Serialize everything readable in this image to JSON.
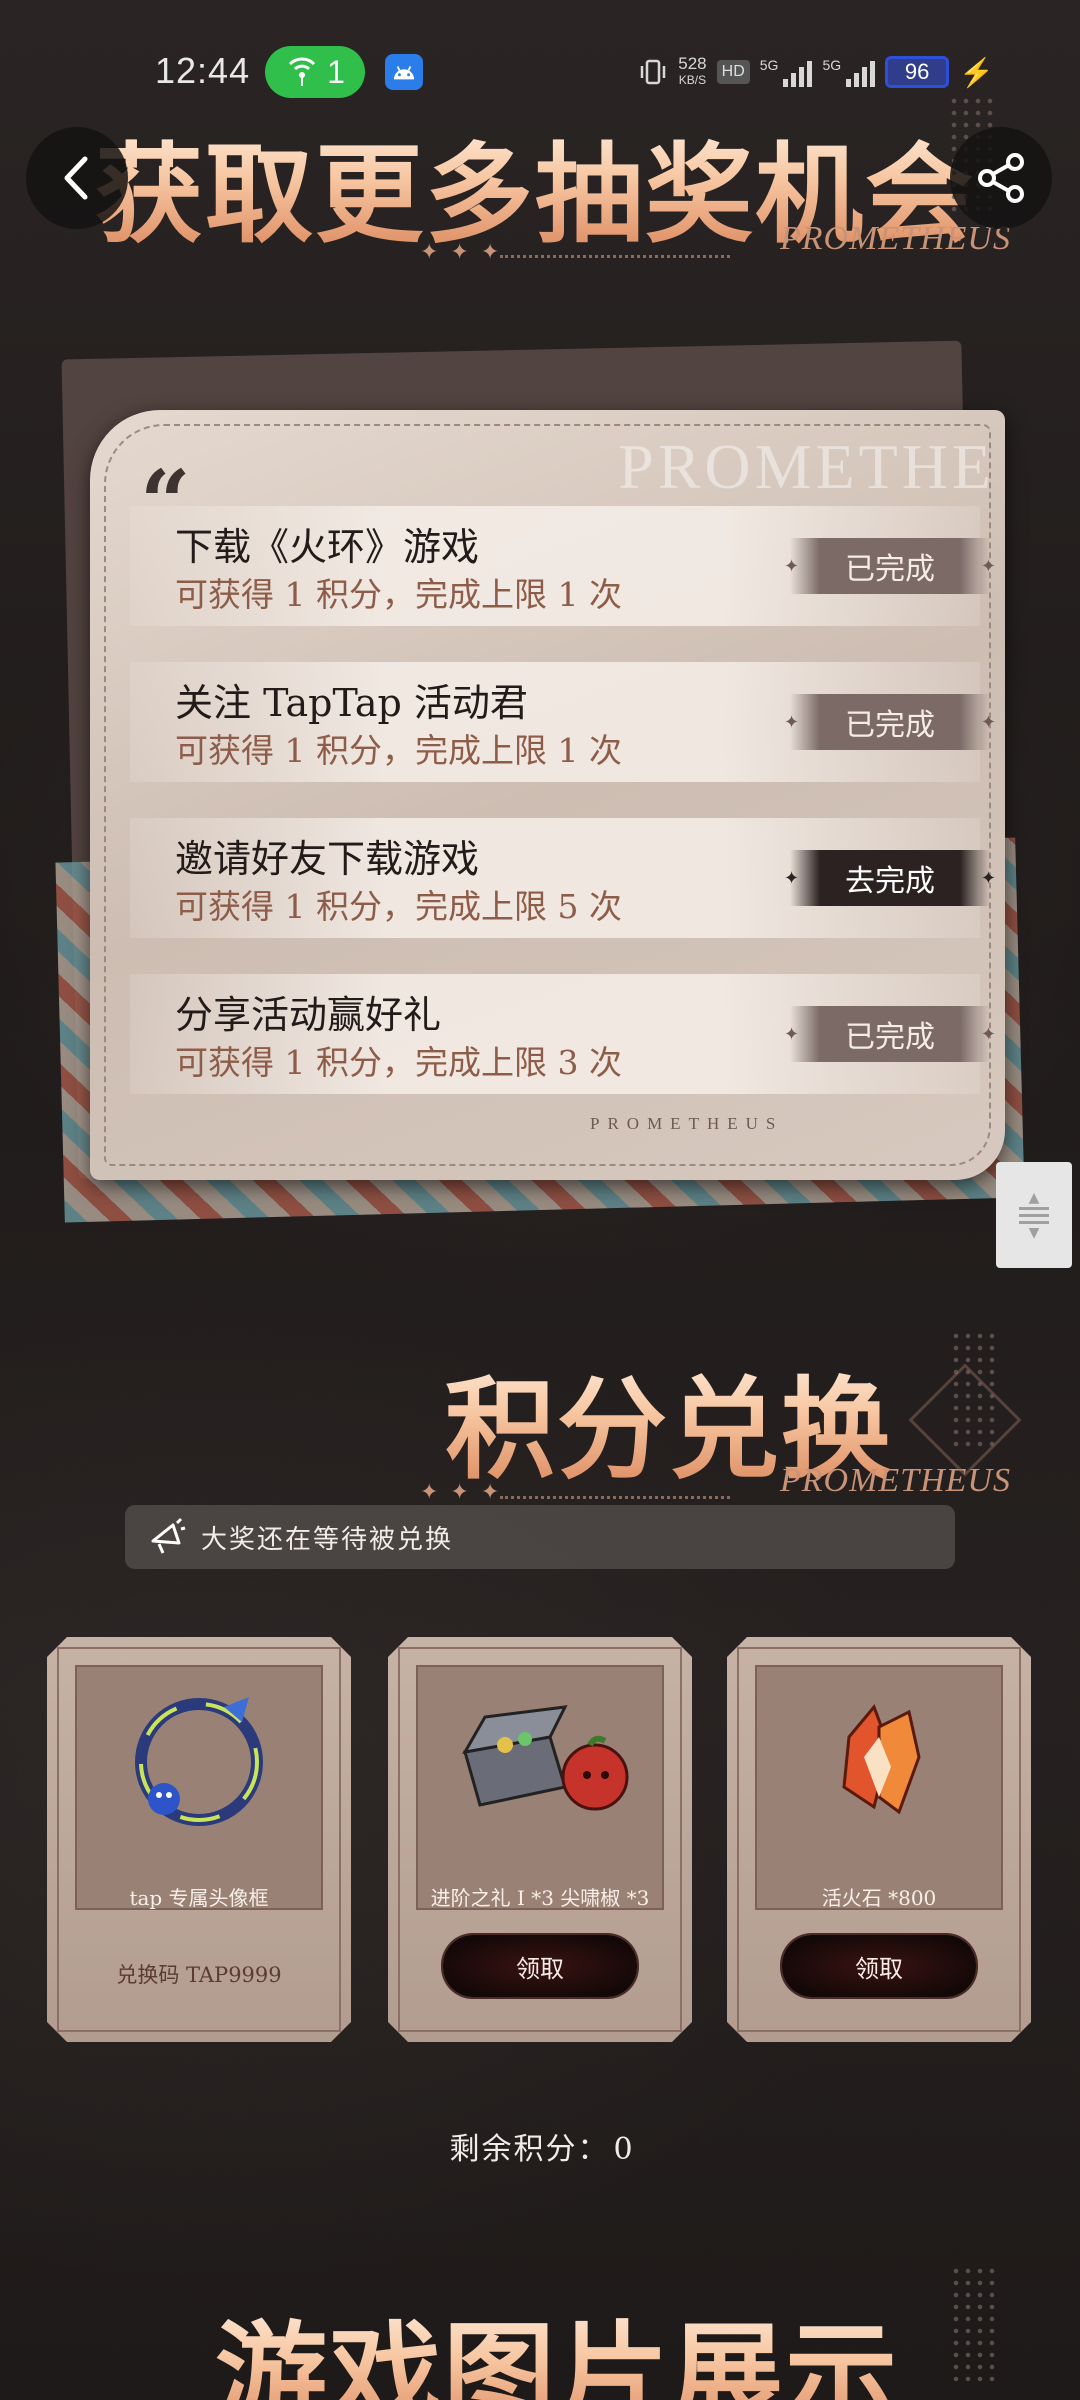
{
  "status_bar": {
    "time": "12:44",
    "hotspot_count": "1",
    "net_speed_value": "528",
    "net_speed_unit": "KB/S",
    "hd_label": "HD",
    "signal1_label": "5G",
    "signal2_label": "5G",
    "battery": "96"
  },
  "header": {
    "title": "获取更多抽奖机会",
    "subtitle": "PROMETHEUS"
  },
  "task_card": {
    "watermark": "PROMETHE",
    "footer": "PROMETHEUS",
    "tasks": [
      {
        "title": "下载《火环》游戏",
        "desc": "可获得 1 积分，完成上限 1 次",
        "button": "已完成",
        "state": "done"
      },
      {
        "title": "关注 TapTap 活动君",
        "desc": "可获得 1 积分，完成上限 1 次",
        "button": "已完成",
        "state": "done"
      },
      {
        "title": "邀请好友下载游戏",
        "desc": "可获得 1 积分，完成上限 5 次",
        "button": "去完成",
        "state": "todo"
      },
      {
        "title": "分享活动赢好礼",
        "desc": "可获得 1 积分，完成上限 3 次",
        "button": "已完成",
        "state": "done"
      }
    ]
  },
  "exchange": {
    "title": "积分兑换",
    "subtitle": "PROMETHEUS",
    "notice": "大奖还在等待被兑换",
    "prizes": [
      {
        "name": "tap 专属头像框",
        "code": "兑换码 TAP9999"
      },
      {
        "name": "进阶之礼 I *3 尖啸椒 *3",
        "button": "领取"
      },
      {
        "name": "活火石 *800",
        "button": "领取"
      }
    ],
    "points_label": "剩余积分：",
    "points_value": "0"
  },
  "gallery": {
    "title": "游戏图片展示"
  },
  "colors": {
    "background": "#221e1d",
    "title_gradient_top": "#fff3e6",
    "title_gradient_bottom": "#d98358",
    "hotspot_green": "#2fbf4a",
    "battery_blue": "#2f4fd8"
  },
  "icons": [
    "hotspot-icon",
    "android-icon",
    "vibrate-icon",
    "back-chevron-icon",
    "share-icon",
    "megaphone-icon",
    "avatar-frame-icon",
    "treasure-chest-icon",
    "fire-crystal-icon"
  ]
}
